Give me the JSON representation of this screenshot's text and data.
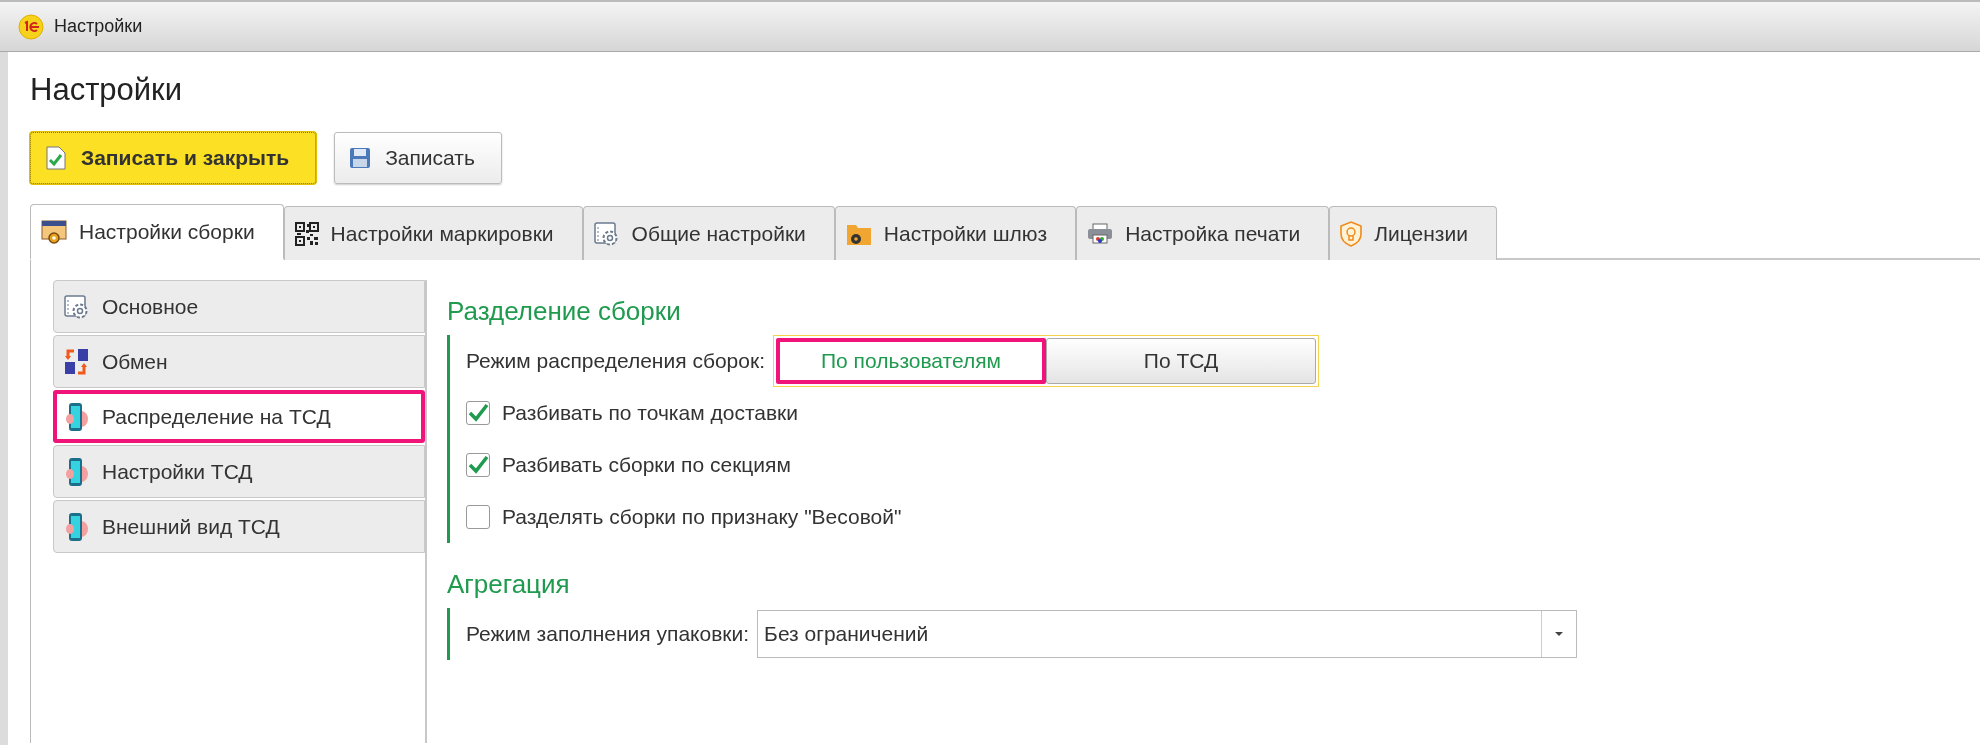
{
  "window": {
    "title": "Настройки"
  },
  "heading": "Настройки",
  "toolbar": [
    {
      "label": "Записать и закрыть",
      "kind": "primary"
    },
    {
      "label": "Записать",
      "kind": "normal"
    }
  ],
  "tabs": [
    {
      "label": "Настройки сборки",
      "selected": true
    },
    {
      "label": "Настройки маркировки",
      "selected": false
    },
    {
      "label": "Общие настройки",
      "selected": false
    },
    {
      "label": "Настройки шлюз",
      "selected": false
    },
    {
      "label": "Настройка печати",
      "selected": false
    },
    {
      "label": "Лицензии",
      "selected": false
    }
  ],
  "sidebar": {
    "items": [
      {
        "label": "Основное",
        "selected": false,
        "highlighted": false
      },
      {
        "label": "Обмен",
        "selected": false,
        "highlighted": false
      },
      {
        "label": "Распределение на ТСД",
        "selected": true,
        "highlighted": true
      },
      {
        "label": "Настройки ТСД",
        "selected": false,
        "highlighted": false
      },
      {
        "label": "Внешний вид ТСД",
        "selected": false,
        "highlighted": false
      }
    ]
  },
  "sections": [
    {
      "title": "Разделение сборки",
      "fields": [
        {
          "kind": "toggle",
          "label": "Режим распределения сборок:",
          "options": [
            {
              "label": "По пользователям",
              "selected": true,
              "highlighted": true
            },
            {
              "label": "По ТСД",
              "selected": false,
              "highlighted": false
            }
          ]
        },
        {
          "kind": "checkbox",
          "label": "Разбивать по точкам доставки",
          "checked": true
        },
        {
          "kind": "checkbox",
          "label": "Разбивать сборки по секциям",
          "checked": true
        },
        {
          "kind": "checkbox",
          "label": "Разделять сборки по признаку \"Весовой\"",
          "checked": false
        }
      ]
    },
    {
      "title": "Агрегация",
      "fields": [
        {
          "kind": "dropdown",
          "label": "Режим заполнения упаковки:",
          "value": "Без ограничений"
        }
      ]
    }
  ]
}
